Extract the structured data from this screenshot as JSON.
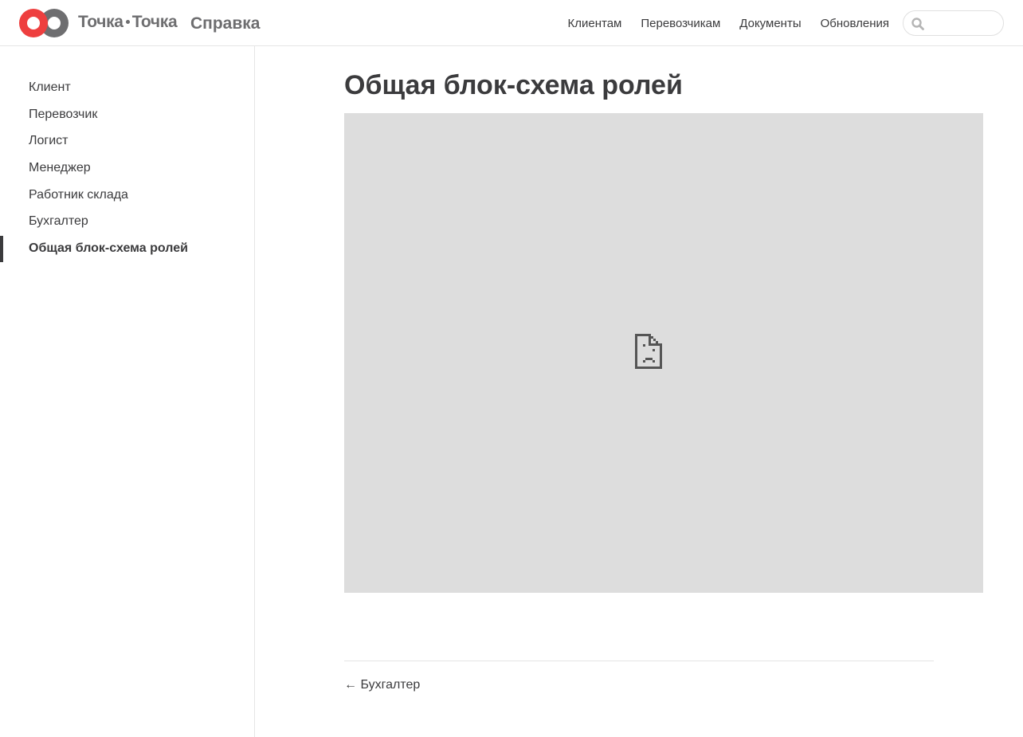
{
  "header": {
    "brand_left": "Точка",
    "brand_right": "Точка",
    "section": "Справка",
    "nav": [
      {
        "label": "Клиентам"
      },
      {
        "label": "Перевозчикам"
      },
      {
        "label": "Документы"
      },
      {
        "label": "Обновления"
      }
    ],
    "search": {
      "value": "",
      "placeholder": "",
      "icon": "search-icon"
    },
    "logo_colors": {
      "left": "#ee3f3f",
      "right": "#6e6e70"
    }
  },
  "sidebar": {
    "items": [
      {
        "label": "Клиент",
        "active": false
      },
      {
        "label": "Перевозчик",
        "active": false
      },
      {
        "label": "Логист",
        "active": false
      },
      {
        "label": "Менеджер",
        "active": false
      },
      {
        "label": "Работник склада",
        "active": false
      },
      {
        "label": "Бухгалтер",
        "active": false
      },
      {
        "label": "Общая блок-схема ролей",
        "active": true
      }
    ]
  },
  "main": {
    "title": "Общая блок-схема ролей",
    "embed": {
      "icon": "broken-document-icon",
      "background": "#dddddd"
    },
    "prev": {
      "arrow": "←",
      "label": "Бухгалтер"
    }
  }
}
